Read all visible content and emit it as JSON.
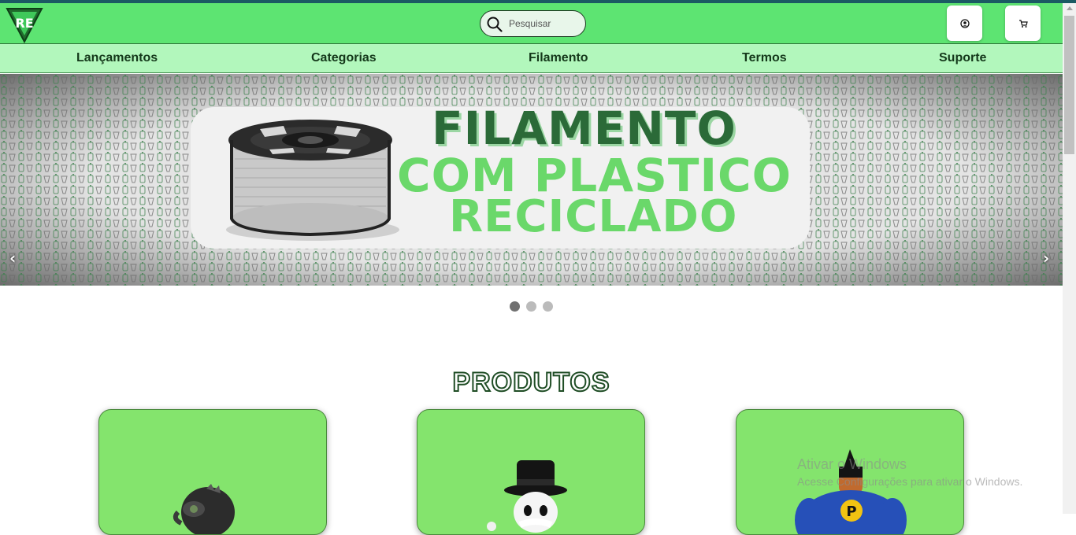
{
  "header": {
    "logo_text": "RE",
    "search_placeholder": "Pesquisar",
    "icons": [
      "search-icon",
      "user-icon",
      "cart-icon"
    ]
  },
  "nav": {
    "items": [
      {
        "label": "Lançamentos"
      },
      {
        "label": "Categorias"
      },
      {
        "label": "Filamento"
      },
      {
        "label": "Termos"
      },
      {
        "label": "Suporte"
      }
    ]
  },
  "banner": {
    "line1": "FILAMENTO",
    "line2": "COM PLASTICO",
    "line3": "RECICLADO",
    "prev": "‹",
    "next": "›",
    "slide_count": 3,
    "active_slide": 1
  },
  "products": {
    "title": "PRODUTOS",
    "items": [
      {
        "icon": "vulture-figure-image"
      },
      {
        "icon": "monopoly-man-figure-image"
      },
      {
        "icon": "superhero-figure-image"
      }
    ]
  },
  "os_watermark": {
    "line1": "Ativar o Windows",
    "line2": "Acesse Configurações para ativar o Windows."
  },
  "colors": {
    "header_green": "#5de472",
    "nav_green": "#b2f7bc",
    "card_green": "#84e46d",
    "dark_green": "#1f4d25"
  }
}
